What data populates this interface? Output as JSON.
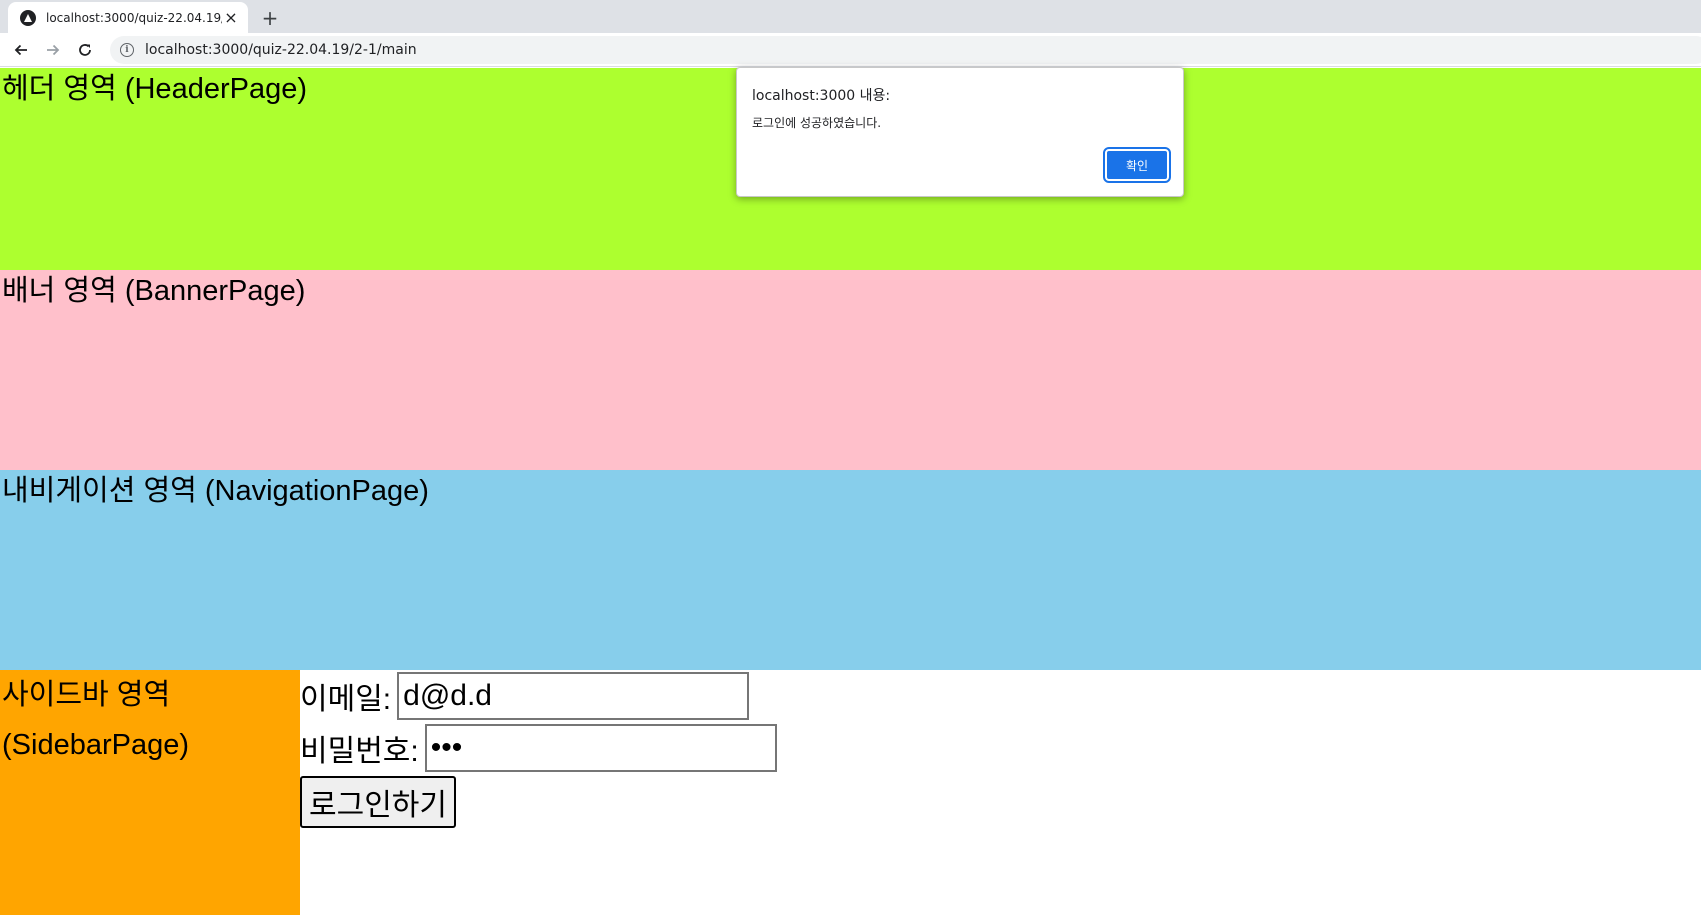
{
  "browser": {
    "tab_title": "localhost:3000/quiz-22.04.19/2-",
    "close_glyph": "×",
    "new_tab_glyph": "+",
    "url": "localhost:3000/quiz-22.04.19/2-1/main",
    "icons": [
      "back-arrow-icon",
      "forward-arrow-icon",
      "reload-icon",
      "site-info-icon",
      "favicon-icon"
    ]
  },
  "sections": {
    "header": {
      "label": "헤더 영역 (HeaderPage)",
      "color": "#adff2f"
    },
    "banner": {
      "label": "배너 영역 (BannerPage)",
      "color": "#ffc0cb"
    },
    "navigation": {
      "label": "내비게이션 영역 (NavigationPage)",
      "color": "#87ceeb"
    },
    "sidebar": {
      "label_line1": "사이드바 영역",
      "label_line2": "(SidebarPage)",
      "color": "#ffa500"
    }
  },
  "login": {
    "email_label": "이메일:",
    "email_value": "d@d.d",
    "password_label": "비밀번호:",
    "password_value": "ddd",
    "submit_label": "로그인하기"
  },
  "alert": {
    "title": "localhost:3000 내용:",
    "message": "로그인에 성공하였습니다.",
    "ok_label": "확인",
    "button_color": "#1a73e8"
  }
}
